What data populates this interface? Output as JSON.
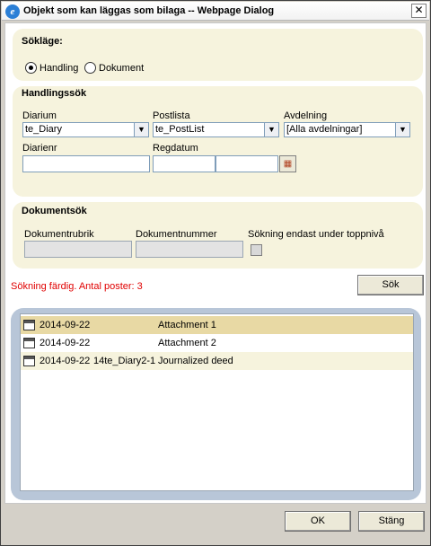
{
  "window": {
    "title": "Objekt som kan läggas som bilaga -- Webpage Dialog",
    "close_glyph": "✕"
  },
  "search_mode": {
    "title": "Sökläge:",
    "options": [
      {
        "label": "Handling",
        "checked": true
      },
      {
        "label": "Dokument",
        "checked": false
      }
    ]
  },
  "handling_search": {
    "title": "Handlingssök",
    "diarium_label": "Diarium",
    "diarium_value": "te_Diary",
    "postlista_label": "Postlista",
    "postlista_value": "te_PostList",
    "avdelning_label": "Avdelning",
    "avdelning_value": "[Alla avdelningar]",
    "diarienr_label": "Diarienr",
    "regdatum_label": "Regdatum"
  },
  "document_search": {
    "title": "Dokumentsök",
    "rubrik_label": "Dokumentrubrik",
    "nummer_label": "Dokumentnummer",
    "toplevel_label": "Sökning endast under toppnivå"
  },
  "status": {
    "message": "Sökning färdig. Antal poster: 3",
    "color": "#e00000"
  },
  "search_button": "Sök",
  "results": [
    {
      "date": "2014-09-22",
      "dnr": "",
      "name": "Attachment 1",
      "selected": true
    },
    {
      "date": "2014-09-22",
      "dnr": "",
      "name": "Attachment 2",
      "selected": false
    },
    {
      "date": "2014-09-22",
      "dnr": "14te_Diary2-1",
      "name": "Journalized deed",
      "selected": false
    }
  ],
  "footer": {
    "ok_label": "OK",
    "close_label": "Stäng"
  },
  "icons": {
    "app": "ie-icon",
    "calendar": "calendar-icon",
    "dropdown": "chevron-down-icon",
    "document": "document-icon"
  },
  "colors": {
    "panel_bg": "#f6f3dd",
    "results_frame": "#b8c6d8",
    "selected_row": "#e8d9a4"
  }
}
